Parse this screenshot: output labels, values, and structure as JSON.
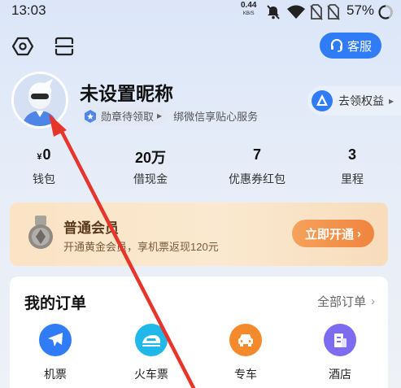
{
  "status_bar": {
    "time": "13:03",
    "net_speed": "0.44",
    "net_unit": "KB/S",
    "battery": "57%",
    "icons": [
      "mute-icon",
      "wifi-icon",
      "no-sim-icon",
      "no-sim-icon",
      "battery-icon"
    ]
  },
  "header": {
    "settings_icon": "settings-icon",
    "scan_icon": "scan-icon",
    "service_label": "客服"
  },
  "profile": {
    "nickname": "未设置昵称",
    "badge_label": "勋章待领取",
    "wechat_text": "绑微信享贴心服务",
    "rights_label": "去领权益"
  },
  "stats": [
    {
      "currency": "¥",
      "value": "0",
      "label": "钱包"
    },
    {
      "currency": "",
      "value": "20万",
      "label": "借现金"
    },
    {
      "currency": "",
      "value": "7",
      "label": "优惠券红包"
    },
    {
      "currency": "",
      "value": "3",
      "label": "里程"
    }
  ],
  "membership": {
    "title": "普通会员",
    "subtitle": "开通黄金会员，享机票返现120元",
    "button": "立即开通"
  },
  "orders": {
    "title": "我的订单",
    "all_label": "全部订单",
    "items": [
      {
        "label": "机票",
        "icon": "plane-icon",
        "color": "#2f7cf6"
      },
      {
        "label": "火车票",
        "icon": "train-icon",
        "color": "#1fb8e8"
      },
      {
        "label": "专车",
        "icon": "car-icon",
        "color": "#f58a2c"
      },
      {
        "label": "酒店",
        "icon": "hotel-icon",
        "color": "#7d6bf0"
      }
    ]
  },
  "colors": {
    "accent": "#2f7cf6",
    "member_button": "#f0843e",
    "annotation_arrow": "#e8352b"
  }
}
